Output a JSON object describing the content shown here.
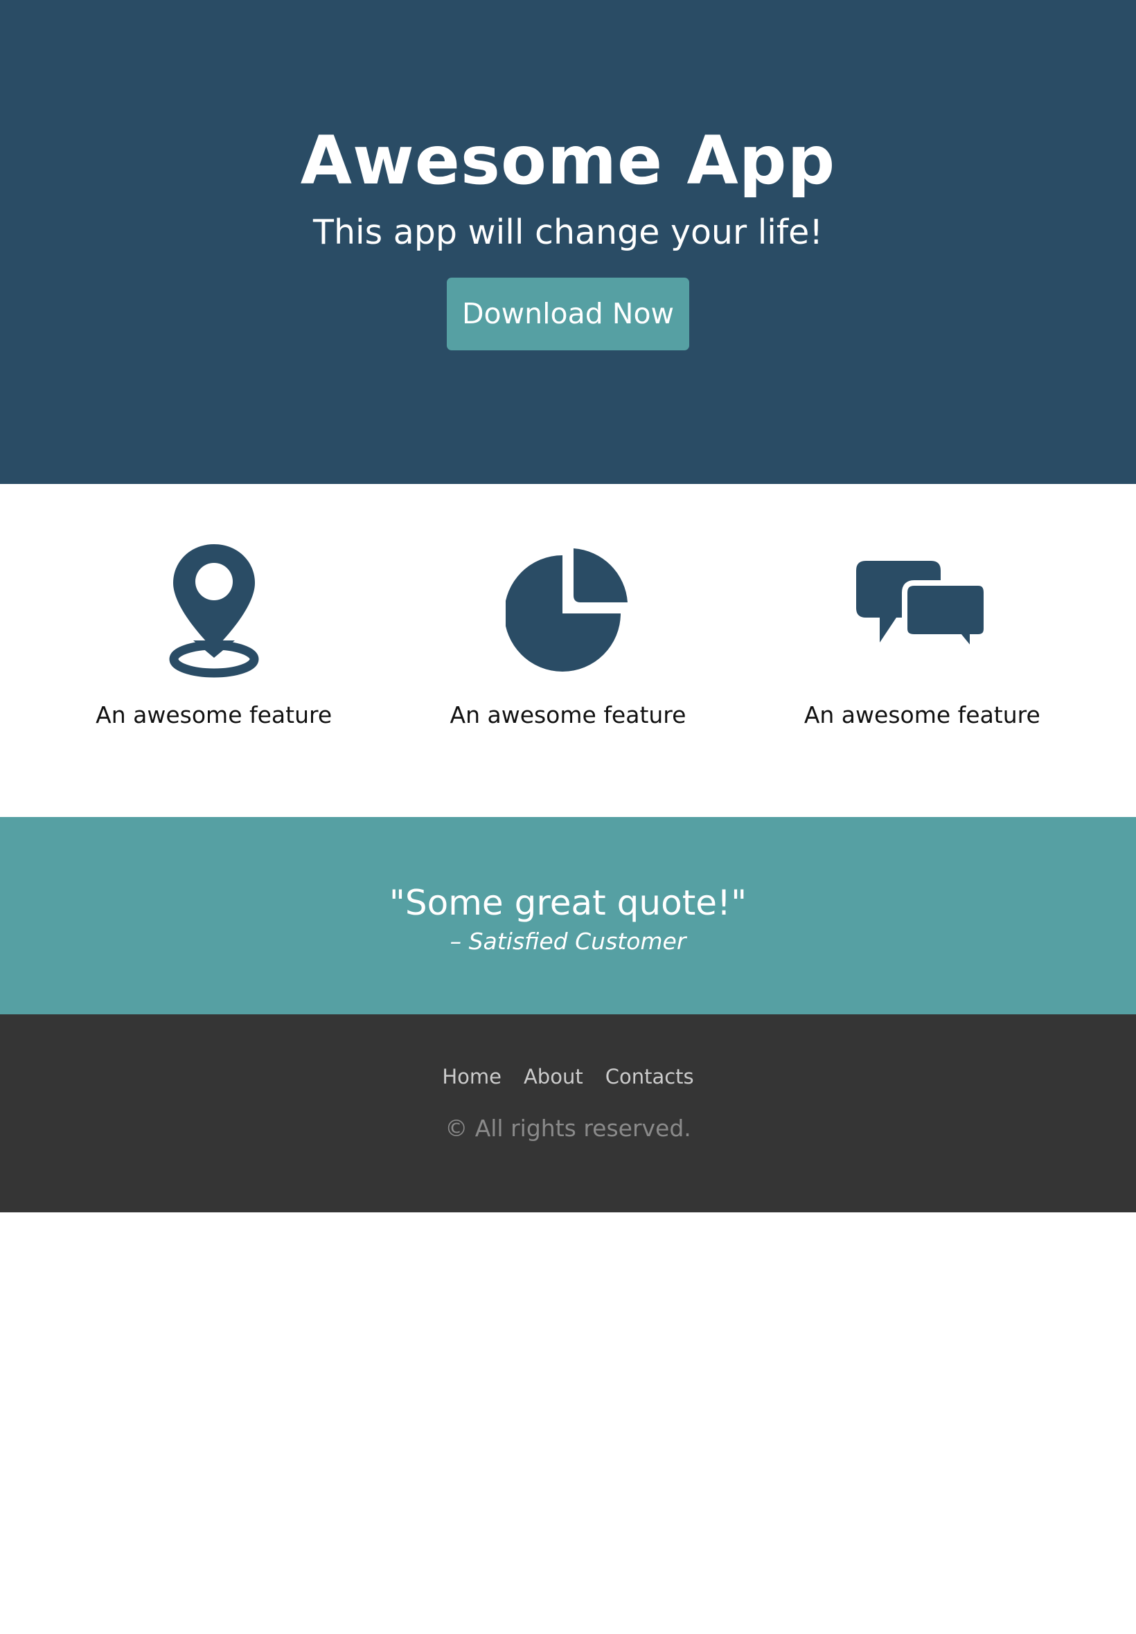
{
  "hero": {
    "title": "Awesome App",
    "subtitle": "This app will change your life!",
    "cta_label": "Download Now"
  },
  "features": [
    {
      "icon": "map-pin-icon",
      "label": "An awesome feature"
    },
    {
      "icon": "pie-chart-icon",
      "label": "An awesome feature"
    },
    {
      "icon": "chat-bubbles-icon",
      "label": "An awesome feature"
    }
  ],
  "quote": {
    "text": "\"Some great quote!\"",
    "author": "– Satisfied Customer"
  },
  "footer": {
    "links": [
      "Home",
      "About",
      "Contacts"
    ],
    "copyright": "© All rights reserved."
  },
  "colors": {
    "primary": "#2a4c65",
    "accent": "#56a0a3",
    "footer_bg": "#353535"
  }
}
